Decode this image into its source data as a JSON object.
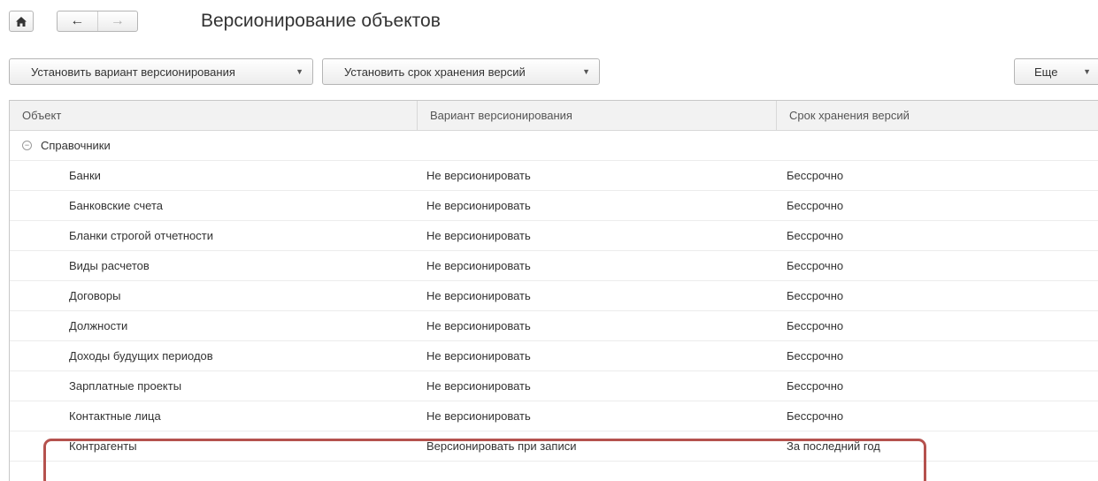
{
  "header": {
    "home_icon": "home-icon",
    "back_icon": "arrow-left-icon",
    "forward_icon": "arrow-right-icon",
    "title": "Версионирование объектов"
  },
  "toolbar": {
    "set_variant_label": "Установить вариант версионирования",
    "set_retention_label": "Установить срок хранения версий",
    "more_label": "Еще"
  },
  "table": {
    "columns": [
      "Объект",
      "Вариант версионирования",
      "Срок хранения версий"
    ],
    "group": {
      "label": "Справочники",
      "expanded": true
    },
    "rows": [
      {
        "object": "Банки",
        "variant": "Не версионировать",
        "retention": "Бессрочно"
      },
      {
        "object": "Банковские счета",
        "variant": "Не версионировать",
        "retention": "Бессрочно"
      },
      {
        "object": "Бланки строгой отчетности",
        "variant": "Не версионировать",
        "retention": "Бессрочно"
      },
      {
        "object": "Виды расчетов",
        "variant": "Не версионировать",
        "retention": "Бессрочно"
      },
      {
        "object": "Договоры",
        "variant": "Не версионировать",
        "retention": "Бессрочно"
      },
      {
        "object": "Должности",
        "variant": "Не версионировать",
        "retention": "Бессрочно"
      },
      {
        "object": "Доходы будущих периодов",
        "variant": "Не версионировать",
        "retention": "Бессрочно"
      },
      {
        "object": "Зарплатные проекты",
        "variant": "Не версионировать",
        "retention": "Бессрочно"
      },
      {
        "object": "Контактные лица",
        "variant": "Не версионировать",
        "retention": "Бессрочно"
      },
      {
        "object": "Контрагенты",
        "variant": "Версионировать при записи",
        "retention": "За последний год"
      }
    ]
  },
  "colors": {
    "highlight": "#b5524e",
    "header_bg": "#f2f2f2"
  }
}
